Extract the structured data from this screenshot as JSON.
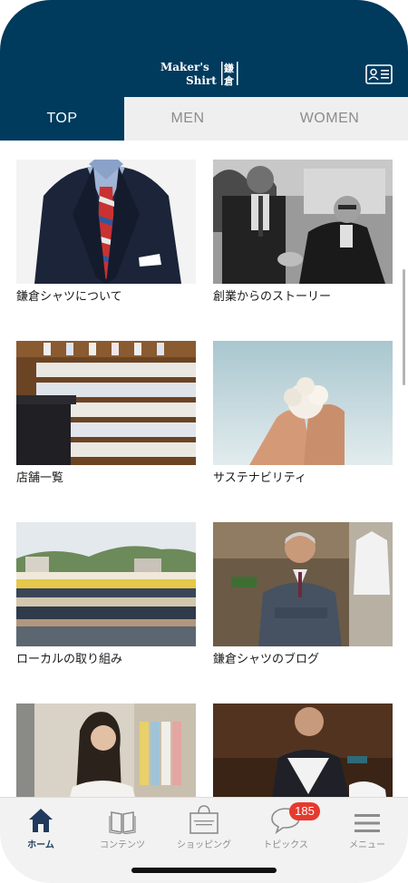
{
  "header": {
    "logo": "Maker's Shirt 鎌倉",
    "member_card_icon": "member-card-icon"
  },
  "tabs": [
    {
      "label": "TOP",
      "active": true
    },
    {
      "label": "MEN",
      "active": false
    },
    {
      "label": "WOMEN",
      "active": false
    }
  ],
  "articles": [
    {
      "label": "鎌倉シャツについて"
    },
    {
      "label": "創業からのストーリー"
    },
    {
      "label": "店舗一覧"
    },
    {
      "label": "サステナビリティ"
    },
    {
      "label": "ローカルの取り組み"
    },
    {
      "label": "鎌倉シャツのブログ"
    },
    {
      "label": ""
    },
    {
      "label": ""
    }
  ],
  "tabbar": {
    "items": [
      {
        "label": "ホーム",
        "icon": "home-icon",
        "active": true
      },
      {
        "label": "コンテンツ",
        "icon": "book-icon",
        "active": false
      },
      {
        "label": "ショッピング",
        "icon": "shopping-bag-icon",
        "active": false
      },
      {
        "label": "トピックス",
        "icon": "chat-bubble-icon",
        "active": false,
        "badge": "185"
      },
      {
        "label": "メニュー",
        "icon": "hamburger-menu-icon",
        "active": false
      }
    ]
  },
  "colors": {
    "brand_navy": "#003a5d",
    "badge_red": "#e63a2e",
    "tab_inactive_bg": "#efefef"
  }
}
